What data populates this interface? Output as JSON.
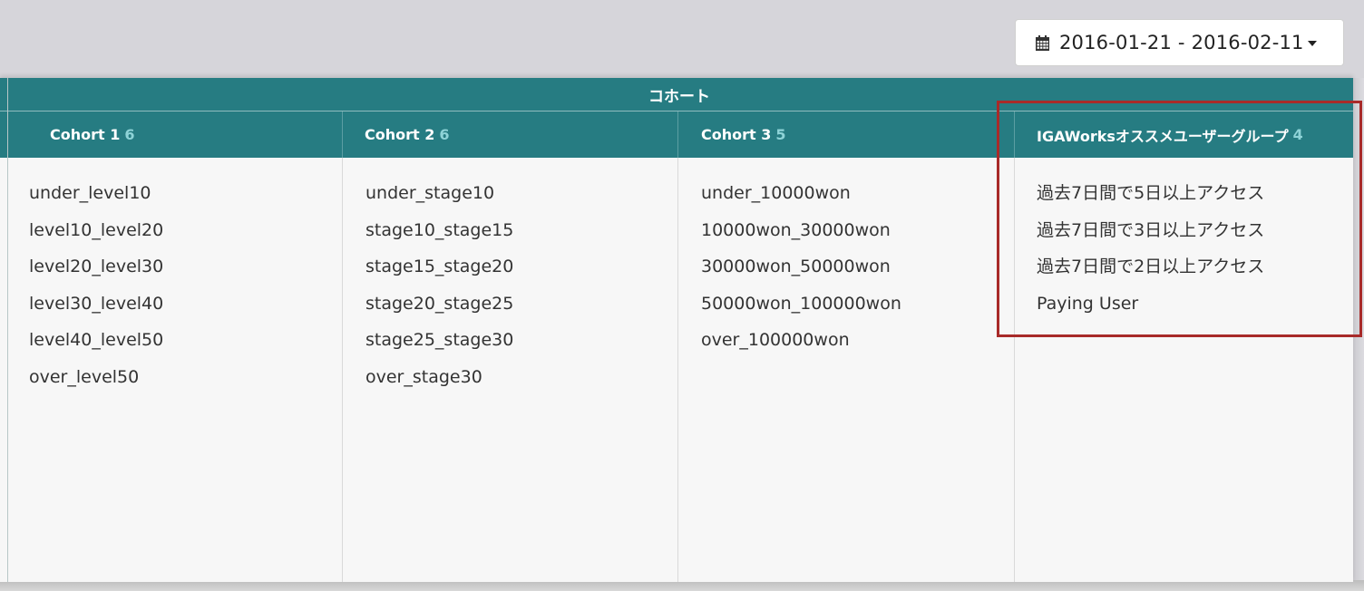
{
  "date_range": {
    "icon": "calendar-icon",
    "label": "2016-01-21 - 2016-02-11"
  },
  "table": {
    "group_title": "コホート",
    "columns": [
      {
        "name": "Cohort 1",
        "count": "6",
        "items": [
          "under_level10",
          "level10_level20",
          "level20_level30",
          "level30_level40",
          "level40_level50",
          "over_level50"
        ]
      },
      {
        "name": "Cohort 2",
        "count": "6",
        "items": [
          "under_stage10",
          "stage10_stage15",
          "stage15_stage20",
          "stage20_stage25",
          "stage25_stage30",
          "over_stage30"
        ]
      },
      {
        "name": "Cohort 3",
        "count": "5",
        "items": [
          "under_10000won",
          "10000won_30000won",
          "30000won_50000won",
          "50000won_100000won",
          "over_100000won"
        ]
      },
      {
        "name": "IGAWorksオススメユーザーグループ",
        "count": "4",
        "items": [
          "過去7日間で5日以上アクセス",
          "過去7日間で3日以上アクセス",
          "過去7日間で2日以上アクセス",
          "Paying User"
        ]
      }
    ]
  },
  "colors": {
    "header": "#267c82",
    "count": "#8ed3d7",
    "highlight": "#a82a29"
  }
}
